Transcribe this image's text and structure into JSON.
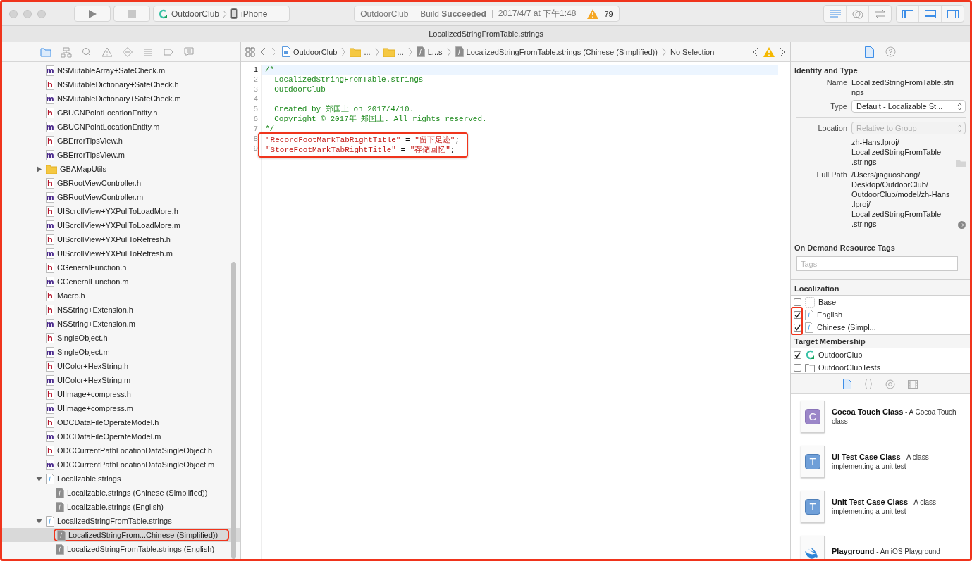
{
  "window": {
    "highlighted": true
  },
  "toolbar": {
    "run_button": {
      "disabled": false
    },
    "stop_button": {
      "disabled": true
    },
    "scheme": {
      "target": "OutdoorClub",
      "device": "iPhone"
    },
    "activity": {
      "project": "OutdoorClub",
      "status": "Build **Succeeded**",
      "time": "2017/4/7 at 下午1:48",
      "warnings": "79"
    },
    "editor_modes": [
      {
        "kind": "standard",
        "selected": true
      },
      {
        "kind": "assistant",
        "selected": false
      },
      {
        "kind": "version",
        "selected": false
      }
    ],
    "panel_toggles": [
      {
        "kind": "navigator",
        "on": true
      },
      {
        "kind": "debug",
        "on": true
      },
      {
        "kind": "utilities",
        "on": true
      }
    ]
  },
  "tab_bar": {
    "title": "LocalizedStringFromTable.strings"
  },
  "navigator": {
    "tabs": [
      {
        "kind": "project",
        "selected": true
      },
      {
        "kind": "symbol",
        "selected": false
      },
      {
        "kind": "find",
        "selected": false
      },
      {
        "kind": "issue",
        "selected": false
      },
      {
        "kind": "test",
        "selected": false
      },
      {
        "kind": "debug",
        "selected": false
      },
      {
        "kind": "breakpoint",
        "selected": false
      },
      {
        "kind": "report",
        "selected": false
      }
    ],
    "items": [
      {
        "kind": "implementation",
        "badge": "m",
        "label": "NSMutableArray+SafeCheck.m",
        "selected": false
      },
      {
        "kind": "header",
        "badge": "h",
        "label": "NSMutableDictionary+SafeCheck.h",
        "selected": false
      },
      {
        "kind": "implementation",
        "badge": "m",
        "label": "NSMutableDictionary+SafeCheck.m",
        "selected": false
      },
      {
        "kind": "header",
        "badge": "h",
        "label": "GBUCNPointLocationEntity.h",
        "selected": false
      },
      {
        "kind": "implementation",
        "badge": "m",
        "label": "GBUCNPointLocationEntity.m",
        "selected": false
      },
      {
        "kind": "header",
        "badge": "h",
        "label": "GBErrorTipsView.h",
        "selected": false
      },
      {
        "kind": "implementation",
        "badge": "m",
        "label": "GBErrorTipsView.m",
        "selected": false
      },
      {
        "kind": "folder",
        "label": "GBAMapUtils",
        "expanded": false,
        "selected": false
      },
      {
        "kind": "header",
        "badge": "h",
        "label": "GBRootViewController.h",
        "selected": false
      },
      {
        "kind": "implementation",
        "badge": "m",
        "label": "GBRootViewController.m",
        "selected": false
      },
      {
        "kind": "header",
        "badge": "h",
        "label": "UIScrollView+YXPullToLoadMore.h",
        "selected": false
      },
      {
        "kind": "implementation",
        "badge": "m",
        "label": "UIScrollView+YXPullToLoadMore.m",
        "selected": false
      },
      {
        "kind": "header",
        "badge": "h",
        "label": "UIScrollView+YXPullToRefresh.h",
        "selected": false
      },
      {
        "kind": "implementation",
        "badge": "m",
        "label": "UIScrollView+YXPullToRefresh.m",
        "selected": false
      },
      {
        "kind": "header",
        "badge": "h",
        "label": "CGeneralFunction.h",
        "selected": false
      },
      {
        "kind": "implementation",
        "badge": "m",
        "label": "CGeneralFunction.m",
        "selected": false
      },
      {
        "kind": "header",
        "badge": "h",
        "label": "Macro.h",
        "selected": false
      },
      {
        "kind": "header",
        "badge": "h",
        "label": "NSString+Extension.h",
        "selected": false
      },
      {
        "kind": "implementation",
        "badge": "m",
        "label": "NSString+Extension.m",
        "selected": false
      },
      {
        "kind": "header",
        "badge": "h",
        "label": "SingleObject.h",
        "selected": false
      },
      {
        "kind": "implementation",
        "badge": "m",
        "label": "SingleObject.m",
        "selected": false
      },
      {
        "kind": "header",
        "badge": "h",
        "label": "UIColor+HexString.h",
        "selected": false
      },
      {
        "kind": "implementation",
        "badge": "m",
        "label": "UIColor+HexString.m",
        "selected": false
      },
      {
        "kind": "header",
        "badge": "h",
        "label": "UIImage+compress.h",
        "selected": false
      },
      {
        "kind": "implementation",
        "badge": "m",
        "label": "UIImage+compress.m",
        "selected": false
      },
      {
        "kind": "header",
        "badge": "h",
        "label": "ODCDataFileOperateModel.h",
        "selected": false
      },
      {
        "kind": "implementation",
        "badge": "m",
        "label": "ODCDataFileOperateModel.m",
        "selected": false
      },
      {
        "kind": "header",
        "badge": "h",
        "label": "ODCCurrentPathLocationDataSingleObject.h",
        "selected": false
      },
      {
        "kind": "implementation",
        "badge": "m",
        "label": "ODCCurrentPathLocationDataSingleObject.m",
        "selected": false
      },
      {
        "kind": "strings",
        "label": "Localizable.strings",
        "expanded": true,
        "selected": false,
        "children": [
          {
            "kind": "strings-file",
            "label": "Localizable.strings (Chinese (Simplified))",
            "selected": false
          },
          {
            "kind": "strings-file",
            "label": "Localizable.strings (English)",
            "selected": false
          }
        ]
      },
      {
        "kind": "strings",
        "label": "LocalizedStringFromTable.strings",
        "expanded": true,
        "selected": false,
        "children": [
          {
            "kind": "strings-file",
            "label": "LocalizedStringFrom...Chinese (Simplified))",
            "selected": true,
            "highlighted": true
          },
          {
            "kind": "strings-file",
            "label": "LocalizedStringFromTable.strings (English)",
            "selected": false
          }
        ]
      }
    ]
  },
  "editor": {
    "jump_bar": [
      {
        "kind": "project",
        "label": "OutdoorClub"
      },
      {
        "kind": "folder",
        "label": "..."
      },
      {
        "kind": "folder",
        "label": "..."
      },
      {
        "kind": "strings",
        "label": "L...s"
      },
      {
        "kind": "strings",
        "label": "LocalizedStringFromTable.strings (Chinese (Simplified))"
      },
      {
        "kind": "plain",
        "label": "No Selection"
      }
    ],
    "lines": [
      {
        "number": "1",
        "current": true,
        "tokens": [
          {
            "kind": "comment",
            "text": "/*"
          }
        ]
      },
      {
        "number": "2",
        "current": false,
        "tokens": [
          {
            "kind": "comment",
            "text": "  LocalizedStringFromTable.strings"
          }
        ]
      },
      {
        "number": "3",
        "current": false,
        "tokens": [
          {
            "kind": "comment",
            "text": "  OutdoorClub"
          }
        ]
      },
      {
        "number": "4",
        "current": false
      },
      {
        "number": "5",
        "current": false,
        "tokens": [
          {
            "kind": "comment",
            "text": "  Created by 郑国上 on 2017/4/10."
          }
        ]
      },
      {
        "number": "6",
        "current": false,
        "tokens": [
          {
            "kind": "comment",
            "text": "  Copyright © 2017年 郑国上. All rights reserved."
          }
        ]
      },
      {
        "number": "7",
        "current": false,
        "tokens": [
          {
            "kind": "comment",
            "text": "*/"
          }
        ]
      },
      {
        "number": "8",
        "current": false,
        "highlighted": true,
        "tokens": [
          {
            "kind": "string",
            "text": "\"RecordFootMarkTabRightTitle\""
          },
          {
            "kind": "plain",
            "text": " = "
          },
          {
            "kind": "string",
            "text": "\"留下足迹\""
          },
          {
            "kind": "plain",
            "text": ";"
          }
        ]
      },
      {
        "number": "9",
        "current": false,
        "highlighted": true,
        "tokens": [
          {
            "kind": "string",
            "text": "\"StoreFootMarkTabRightTitle\""
          },
          {
            "kind": "plain",
            "text": " = "
          },
          {
            "kind": "string",
            "text": "\"存储回忆\""
          },
          {
            "kind": "plain",
            "text": ";"
          }
        ]
      }
    ]
  },
  "inspector": {
    "tabs": [
      {
        "kind": "file",
        "selected": true
      },
      {
        "kind": "help",
        "selected": false
      }
    ],
    "identity": {
      "title": "Identity and Type",
      "name_label": "Name",
      "name": "LocalizedStringFromTable.strings",
      "type_label": "Type",
      "type": "Default - Localizable St...",
      "location_label": "Location",
      "location": "Relative to Group",
      "location_disabled": true,
      "relative_path": "zh-Hans.lproj/LocalizedStringFromTable.strings",
      "full_path_label": "Full Path",
      "full_path": "/Users/jiaguoshang/Desktop/OutdoorClub/OutdoorClub/model/zh-Hans.lproj/LocalizedStringFromTable.strings"
    },
    "tags": {
      "title": "On Demand Resource Tags",
      "placeholder": "Tags"
    },
    "localization": {
      "title": "Localization",
      "items": [
        {
          "kind": "base",
          "label": "Base",
          "checked": false
        },
        {
          "kind": "strings",
          "label": "English",
          "checked": true,
          "highlighted": true
        },
        {
          "kind": "strings",
          "label": "Chinese (Simpl...",
          "checked": true,
          "highlighted": true
        }
      ]
    },
    "target_membership": {
      "title": "Target Membership",
      "items": [
        {
          "kind": "app",
          "label": "OutdoorClub",
          "checked": true
        },
        {
          "kind": "tests",
          "label": "OutdoorClubTests",
          "checked": false
        }
      ]
    }
  },
  "library": {
    "tabs": [
      {
        "kind": "file",
        "selected": true
      },
      {
        "kind": "code",
        "selected": false
      },
      {
        "kind": "object",
        "selected": false
      },
      {
        "kind": "media",
        "selected": false
      }
    ],
    "templates": [
      {
        "kind": "class",
        "badge": "C",
        "text": "**Cocoa Touch Class** - A Cocoa Touch class"
      },
      {
        "kind": "test",
        "badge": "T",
        "text": "**UI Test Case Class** - A class implementing a unit test"
      },
      {
        "kind": "test",
        "badge": "T",
        "text": "**Unit Test Case Class** - A class implementing a unit test"
      },
      {
        "kind": "swift",
        "text": "**Playground** - An iOS Playground"
      }
    ]
  }
}
